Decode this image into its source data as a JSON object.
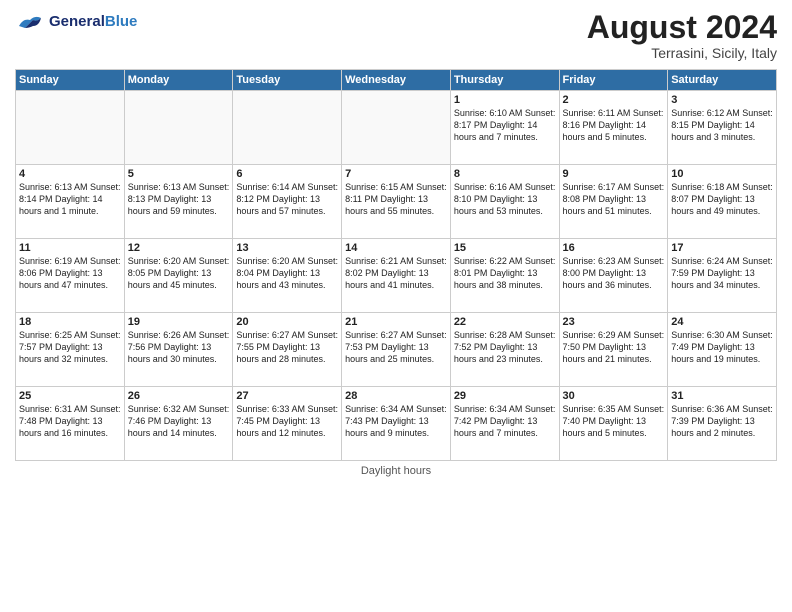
{
  "header": {
    "logo_general": "General",
    "logo_blue": "Blue",
    "month": "August 2024",
    "location": "Terrasini, Sicily, Italy"
  },
  "footer": {
    "note": "Daylight hours"
  },
  "days_of_week": [
    "Sunday",
    "Monday",
    "Tuesday",
    "Wednesday",
    "Thursday",
    "Friday",
    "Saturday"
  ],
  "weeks": [
    [
      {
        "day": "",
        "info": ""
      },
      {
        "day": "",
        "info": ""
      },
      {
        "day": "",
        "info": ""
      },
      {
        "day": "",
        "info": ""
      },
      {
        "day": "1",
        "info": "Sunrise: 6:10 AM\nSunset: 8:17 PM\nDaylight: 14 hours\nand 7 minutes."
      },
      {
        "day": "2",
        "info": "Sunrise: 6:11 AM\nSunset: 8:16 PM\nDaylight: 14 hours\nand 5 minutes."
      },
      {
        "day": "3",
        "info": "Sunrise: 6:12 AM\nSunset: 8:15 PM\nDaylight: 14 hours\nand 3 minutes."
      }
    ],
    [
      {
        "day": "4",
        "info": "Sunrise: 6:13 AM\nSunset: 8:14 PM\nDaylight: 14 hours\nand 1 minute."
      },
      {
        "day": "5",
        "info": "Sunrise: 6:13 AM\nSunset: 8:13 PM\nDaylight: 13 hours\nand 59 minutes."
      },
      {
        "day": "6",
        "info": "Sunrise: 6:14 AM\nSunset: 8:12 PM\nDaylight: 13 hours\nand 57 minutes."
      },
      {
        "day": "7",
        "info": "Sunrise: 6:15 AM\nSunset: 8:11 PM\nDaylight: 13 hours\nand 55 minutes."
      },
      {
        "day": "8",
        "info": "Sunrise: 6:16 AM\nSunset: 8:10 PM\nDaylight: 13 hours\nand 53 minutes."
      },
      {
        "day": "9",
        "info": "Sunrise: 6:17 AM\nSunset: 8:08 PM\nDaylight: 13 hours\nand 51 minutes."
      },
      {
        "day": "10",
        "info": "Sunrise: 6:18 AM\nSunset: 8:07 PM\nDaylight: 13 hours\nand 49 minutes."
      }
    ],
    [
      {
        "day": "11",
        "info": "Sunrise: 6:19 AM\nSunset: 8:06 PM\nDaylight: 13 hours\nand 47 minutes."
      },
      {
        "day": "12",
        "info": "Sunrise: 6:20 AM\nSunset: 8:05 PM\nDaylight: 13 hours\nand 45 minutes."
      },
      {
        "day": "13",
        "info": "Sunrise: 6:20 AM\nSunset: 8:04 PM\nDaylight: 13 hours\nand 43 minutes."
      },
      {
        "day": "14",
        "info": "Sunrise: 6:21 AM\nSunset: 8:02 PM\nDaylight: 13 hours\nand 41 minutes."
      },
      {
        "day": "15",
        "info": "Sunrise: 6:22 AM\nSunset: 8:01 PM\nDaylight: 13 hours\nand 38 minutes."
      },
      {
        "day": "16",
        "info": "Sunrise: 6:23 AM\nSunset: 8:00 PM\nDaylight: 13 hours\nand 36 minutes."
      },
      {
        "day": "17",
        "info": "Sunrise: 6:24 AM\nSunset: 7:59 PM\nDaylight: 13 hours\nand 34 minutes."
      }
    ],
    [
      {
        "day": "18",
        "info": "Sunrise: 6:25 AM\nSunset: 7:57 PM\nDaylight: 13 hours\nand 32 minutes."
      },
      {
        "day": "19",
        "info": "Sunrise: 6:26 AM\nSunset: 7:56 PM\nDaylight: 13 hours\nand 30 minutes."
      },
      {
        "day": "20",
        "info": "Sunrise: 6:27 AM\nSunset: 7:55 PM\nDaylight: 13 hours\nand 28 minutes."
      },
      {
        "day": "21",
        "info": "Sunrise: 6:27 AM\nSunset: 7:53 PM\nDaylight: 13 hours\nand 25 minutes."
      },
      {
        "day": "22",
        "info": "Sunrise: 6:28 AM\nSunset: 7:52 PM\nDaylight: 13 hours\nand 23 minutes."
      },
      {
        "day": "23",
        "info": "Sunrise: 6:29 AM\nSunset: 7:50 PM\nDaylight: 13 hours\nand 21 minutes."
      },
      {
        "day": "24",
        "info": "Sunrise: 6:30 AM\nSunset: 7:49 PM\nDaylight: 13 hours\nand 19 minutes."
      }
    ],
    [
      {
        "day": "25",
        "info": "Sunrise: 6:31 AM\nSunset: 7:48 PM\nDaylight: 13 hours\nand 16 minutes."
      },
      {
        "day": "26",
        "info": "Sunrise: 6:32 AM\nSunset: 7:46 PM\nDaylight: 13 hours\nand 14 minutes."
      },
      {
        "day": "27",
        "info": "Sunrise: 6:33 AM\nSunset: 7:45 PM\nDaylight: 13 hours\nand 12 minutes."
      },
      {
        "day": "28",
        "info": "Sunrise: 6:34 AM\nSunset: 7:43 PM\nDaylight: 13 hours\nand 9 minutes."
      },
      {
        "day": "29",
        "info": "Sunrise: 6:34 AM\nSunset: 7:42 PM\nDaylight: 13 hours\nand 7 minutes."
      },
      {
        "day": "30",
        "info": "Sunrise: 6:35 AM\nSunset: 7:40 PM\nDaylight: 13 hours\nand 5 minutes."
      },
      {
        "day": "31",
        "info": "Sunrise: 6:36 AM\nSunset: 7:39 PM\nDaylight: 13 hours\nand 2 minutes."
      }
    ]
  ]
}
